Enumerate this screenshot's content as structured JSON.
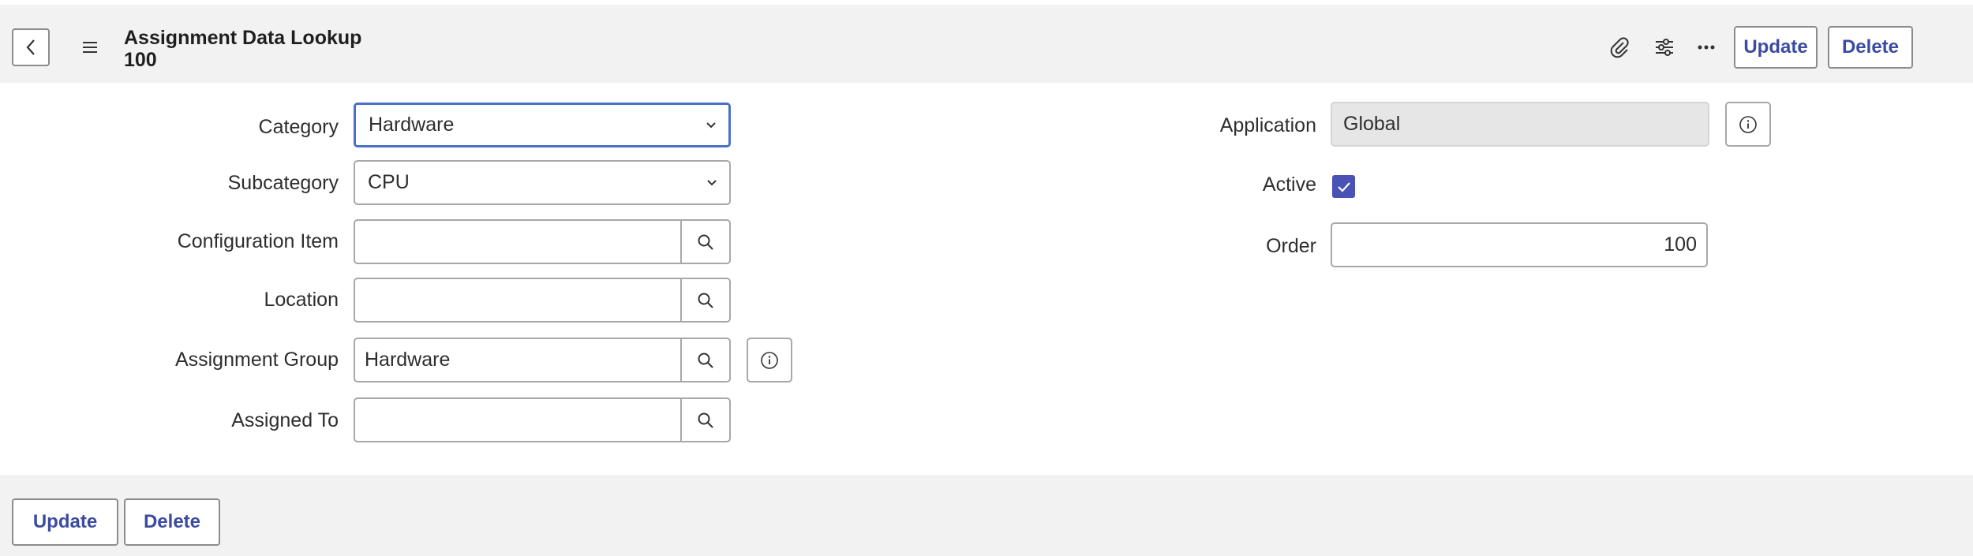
{
  "header": {
    "title": "Assignment Data Lookup",
    "record_number": "100",
    "update_label": "Update",
    "delete_label": "Delete"
  },
  "form": {
    "category": {
      "label": "Category",
      "value": "Hardware"
    },
    "subcategory": {
      "label": "Subcategory",
      "value": "CPU"
    },
    "configuration_item": {
      "label": "Configuration Item",
      "value": ""
    },
    "location": {
      "label": "Location",
      "value": ""
    },
    "assignment_group": {
      "label": "Assignment Group",
      "value": "Hardware"
    },
    "assigned_to": {
      "label": "Assigned To",
      "value": ""
    },
    "application": {
      "label": "Application",
      "value": "Global"
    },
    "active": {
      "label": "Active",
      "checked": true
    },
    "order": {
      "label": "Order",
      "value": "100"
    }
  },
  "footer": {
    "update_label": "Update",
    "delete_label": "Delete"
  },
  "colors": {
    "accent": "#3b4ba0",
    "checkbox": "#4a52b5",
    "focus": "#4a70c9",
    "header_bg": "#f2f2f2"
  },
  "icons": [
    "back-icon",
    "menu-icon",
    "attachment-icon",
    "settings-sliders-icon",
    "more-icon",
    "chevron-down-icon",
    "search-icon",
    "info-icon",
    "checkmark-icon"
  ]
}
